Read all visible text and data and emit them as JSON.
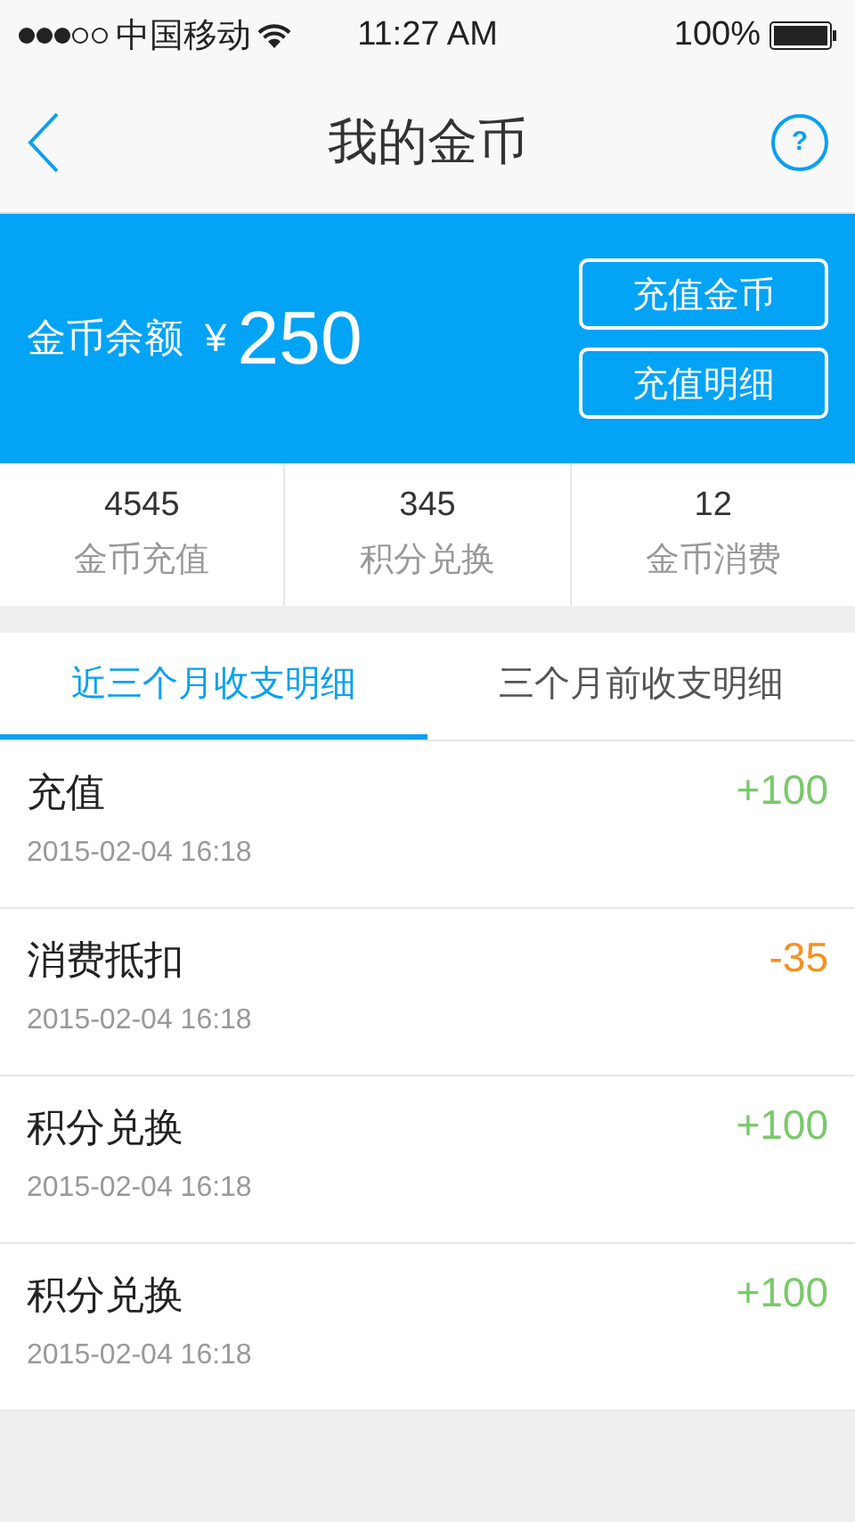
{
  "status_bar": {
    "carrier": "中国移动",
    "time": "11:27 AM",
    "battery": "100%"
  },
  "nav": {
    "title": "我的金币",
    "help": "?"
  },
  "balance": {
    "label": "金币余额",
    "currency": "¥",
    "amount": "250",
    "buttons": [
      "充值金币",
      "充值明细"
    ]
  },
  "stats": [
    {
      "value": "4545",
      "label": "金币充值"
    },
    {
      "value": "345",
      "label": "积分兑换"
    },
    {
      "value": "12",
      "label": "金币消费"
    }
  ],
  "tabs": [
    {
      "label": "近三个月收支明细",
      "selected": true
    },
    {
      "label": "三个月前收支明细",
      "selected": false
    }
  ],
  "records": [
    {
      "title": "充值",
      "time": "2015-02-04 16:18",
      "amount": "+100",
      "kind": "income"
    },
    {
      "title": "消费抵扣",
      "time": "2015-02-04 16:18",
      "amount": "-35",
      "kind": "expense"
    },
    {
      "title": "积分兑换",
      "time": "2015-02-04 16:18",
      "amount": "+100",
      "kind": "income"
    },
    {
      "title": "积分兑换",
      "time": "2015-02-04 16:18",
      "amount": "+100",
      "kind": "income"
    }
  ]
}
